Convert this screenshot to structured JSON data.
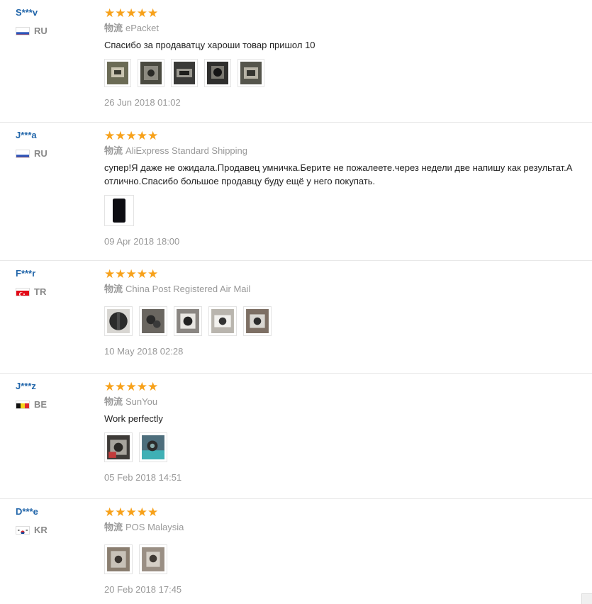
{
  "shipping_label": "物流",
  "star_glyphs": "★★★★★",
  "reviews": [
    {
      "user": "S***v",
      "country": "RU",
      "flag": "ru",
      "shipping": "ePacket",
      "text": [
        "Спасибо за продаватцу хароши товар пришол 10"
      ],
      "photos": [
        "#6b6b55",
        "#4a4a40",
        "#3a3a38",
        "#2f2f2d",
        "#55554c"
      ],
      "date": "26 Jun 2018 01:02"
    },
    {
      "user": "J***a",
      "country": "RU",
      "flag": "ru",
      "shipping": "AliExpress Standard Shipping",
      "text": [
        "супер!Я даже не ожидала.Продавец умничка.Берите не пожалеете.через недели две напишу как результат.А",
        "отлично.Спасибо большое продавцу буду ещё у него покупать."
      ],
      "photos": [
        "#0d0d12"
      ],
      "date": "09 Apr 2018 18:00"
    },
    {
      "user": "F***r",
      "country": "TR",
      "flag": "tr",
      "shipping": "China Post Registered Air Mail",
      "text": [],
      "photos": [
        "#2b2b2b",
        "#6a6660",
        "#8a8682",
        "#b9b5ae",
        "#7d6f64"
      ],
      "date": "10 May 2018 02:28"
    },
    {
      "user": "J***z",
      "country": "BE",
      "flag": "be",
      "shipping": "SunYou",
      "text": [
        "Work perfectly"
      ],
      "photos": [
        "#3e3b38",
        "#4d6e7c"
      ],
      "date": "05 Feb 2018 14:51"
    },
    {
      "user": "D***e",
      "country": "KR",
      "flag": "kr",
      "shipping": "POS Malaysia",
      "text": [],
      "photos": [
        "#8a7e70",
        "#9a8f84"
      ],
      "date": "20 Feb 2018 17:45"
    }
  ]
}
